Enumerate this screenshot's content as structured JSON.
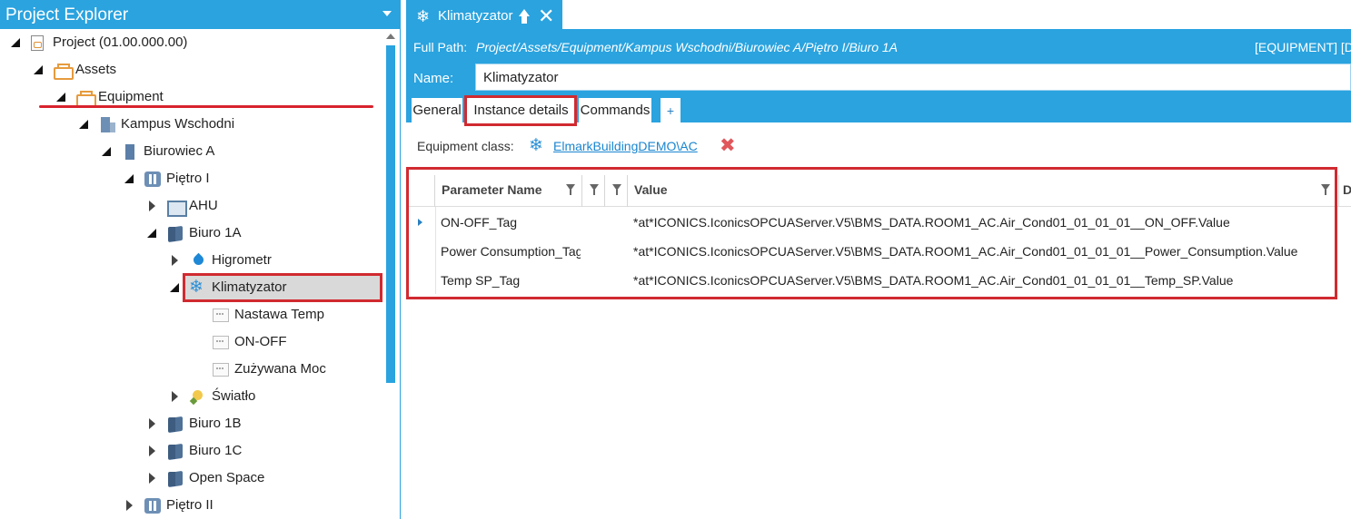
{
  "explorer": {
    "title": "Project Explorer",
    "tree": [
      {
        "label": "Project (01.00.000.00)",
        "icon": "project-icon",
        "state": "expanded"
      },
      {
        "label": "Assets",
        "icon": "assets-icon",
        "state": "expanded"
      },
      {
        "label": "Equipment",
        "icon": "equipment-icon",
        "state": "expanded"
      },
      {
        "label": "Kampus Wschodni",
        "icon": "campus-icon",
        "state": "expanded"
      },
      {
        "label": "Biurowiec A",
        "icon": "building-icon",
        "state": "expanded"
      },
      {
        "label": "Piętro I",
        "icon": "floor-icon",
        "state": "expanded"
      },
      {
        "label": "AHU",
        "icon": "ahu-icon",
        "state": "collapsed"
      },
      {
        "label": "Biuro 1A",
        "icon": "room-icon",
        "state": "expanded"
      },
      {
        "label": "Higrometr",
        "icon": "hygrometer-icon",
        "state": "collapsed"
      },
      {
        "label": "Klimatyzator",
        "icon": "snowflake-icon",
        "state": "expanded",
        "selected": true
      },
      {
        "label": "Nastawa Temp",
        "icon": "tag-icon",
        "state": "leaf"
      },
      {
        "label": "ON-OFF",
        "icon": "tag-icon",
        "state": "leaf"
      },
      {
        "label": "Zużywana Moc",
        "icon": "tag-icon",
        "state": "leaf"
      },
      {
        "label": "Światło",
        "icon": "light-icon",
        "state": "collapsed"
      },
      {
        "label": "Biuro 1B",
        "icon": "room-icon",
        "state": "collapsed"
      },
      {
        "label": "Biuro 1C",
        "icon": "room-icon",
        "state": "collapsed"
      },
      {
        "label": "Open Space",
        "icon": "room-icon",
        "state": "collapsed"
      },
      {
        "label": "Piętro II",
        "icon": "floor-icon",
        "state": "collapsed"
      }
    ]
  },
  "document": {
    "tab_title": "Klimatyzator",
    "full_path_label": "Full Path:",
    "full_path": "Project/Assets/Equipment/Kampus Wschodni/Biurowiec A/Piętro I/Biuro 1A",
    "path_kind": "[EQUIPMENT] [D",
    "name_label": "Name:",
    "name_value": "Klimatyzator",
    "tabs": [
      {
        "label": "General"
      },
      {
        "label": "Instance details",
        "active": true
      },
      {
        "label": "Commands"
      },
      {
        "label": "+"
      }
    ],
    "equipment_class_label": "Equipment class:",
    "equipment_class_link": "ElmarkBuildingDEMO\\AC"
  },
  "grid": {
    "columns": [
      "Parameter Name",
      "Value",
      "D"
    ],
    "rows": [
      {
        "name": "ON-OFF_Tag",
        "value": "*at*ICONICS.IconicsOPCUAServer.V5\\BMS_DATA.ROOM1_AC.Air_Cond01_01_01_01__ON_OFF.Value"
      },
      {
        "name": "Power Consumption_Tag",
        "value": "*at*ICONICS.IconicsOPCUAServer.V5\\BMS_DATA.ROOM1_AC.Air_Cond01_01_01_01__Power_Consumption.Value"
      },
      {
        "name": "Temp SP_Tag",
        "value": "*at*ICONICS.IconicsOPCUAServer.V5\\BMS_DATA.ROOM1_AC.Air_Cond01_01_01_01__Temp_SP.Value"
      }
    ]
  },
  "colors": {
    "accent": "#2aa3df",
    "highlight": "#d02a30",
    "link": "#1a86d0"
  }
}
